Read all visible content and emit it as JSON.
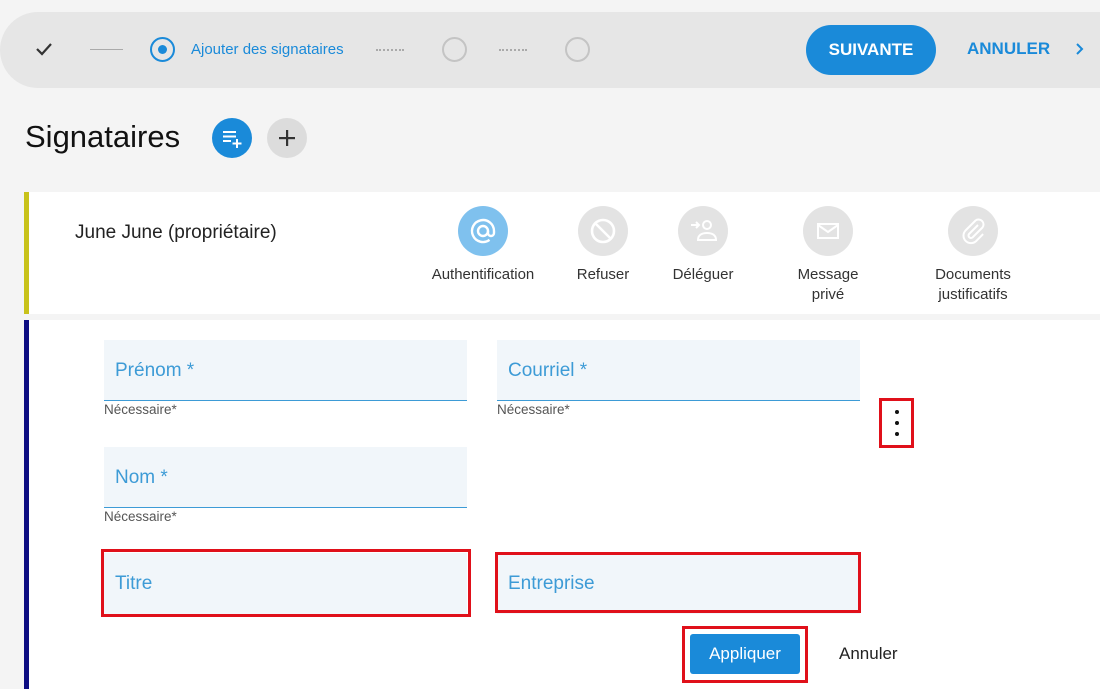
{
  "stepper": {
    "current_step_label": "Ajouter des signataires",
    "next_label": "SUIVANTE",
    "cancel_label": "ANNULER"
  },
  "header": {
    "title": "Signataires"
  },
  "owner": {
    "name": "June June (propriétaire)",
    "actions": [
      {
        "label": "Authentification",
        "icon": "at-icon",
        "active": true
      },
      {
        "label": "Refuser",
        "icon": "block-icon",
        "active": false
      },
      {
        "label": "Déléguer",
        "icon": "delegate-icon",
        "active": false
      },
      {
        "label": "Message\nprivé",
        "icon": "mail-icon",
        "active": false
      },
      {
        "label": "Documents\njustificatifs",
        "icon": "paperclip-icon",
        "active": false
      }
    ]
  },
  "form": {
    "prenom_placeholder": "Prénom *",
    "courriel_placeholder": "Courriel *",
    "nom_placeholder": "Nom *",
    "titre_placeholder": "Titre",
    "entreprise_placeholder": "Entreprise",
    "required_helper": "Nécessaire*",
    "apply_label": "Appliquer",
    "cancel_label": "Annuler"
  },
  "colors": {
    "accent": "#1a8ad9",
    "owner_bar": "#c8c21a",
    "signer_bar": "#0d0d82",
    "highlight": "#e0101a"
  }
}
